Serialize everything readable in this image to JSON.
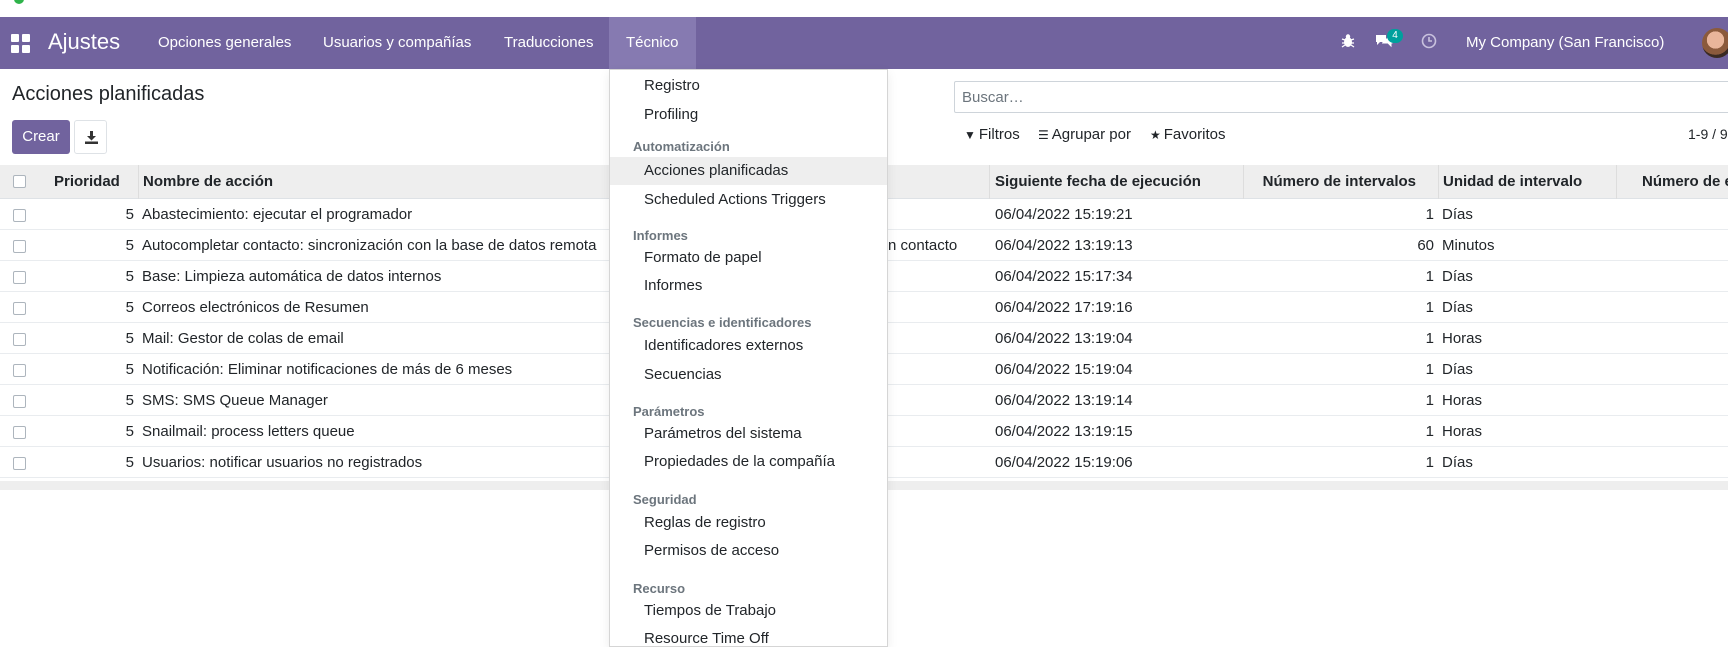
{
  "navbar": {
    "brand": "Ajustes",
    "menus": [
      "Opciones generales",
      "Usuarios y compañías",
      "Traducciones",
      "Técnico"
    ],
    "active_menu": "Técnico",
    "chat_badge": "4",
    "company": "My Company (San Francisco)"
  },
  "control_panel": {
    "title": "Acciones planificadas",
    "create_label": "Crear",
    "search_placeholder": "Buscar…",
    "filters_label": "Filtros",
    "group_by_label": "Agrupar por",
    "favorites_label": "Favoritos",
    "pager": "1-9 / 9"
  },
  "list": {
    "columns": {
      "priority": "Prioridad",
      "name": "Nombre de acción",
      "next_date": "Siguiente fecha de ejecución",
      "interval_number": "Número de intervalos",
      "interval_unit": "Unidad de intervalo",
      "calls": "Número de e"
    },
    "rows": [
      {
        "priority": "5",
        "name": "Abastecimiento: ejecutar el programador",
        "model": "",
        "next_date": "06/04/2022 15:19:21",
        "interval_number": "1",
        "interval_unit": "Días"
      },
      {
        "priority": "5",
        "name": "Autocompletar contacto: sincronización con la base de datos remota",
        "model": "n contacto",
        "next_date": "06/04/2022 13:19:13",
        "interval_number": "60",
        "interval_unit": "Minutos"
      },
      {
        "priority": "5",
        "name": "Base: Limpieza automática de datos internos",
        "model": "",
        "next_date": "06/04/2022 15:17:34",
        "interval_number": "1",
        "interval_unit": "Días"
      },
      {
        "priority": "5",
        "name": "Correos electrónicos de Resumen",
        "model": "",
        "next_date": "06/04/2022 17:19:16",
        "interval_number": "1",
        "interval_unit": "Días"
      },
      {
        "priority": "5",
        "name": "Mail: Gestor de colas de email",
        "model": "",
        "next_date": "06/04/2022 13:19:04",
        "interval_number": "1",
        "interval_unit": "Horas"
      },
      {
        "priority": "5",
        "name": "Notificación: Eliminar notificaciones de más de 6 meses",
        "model": "",
        "next_date": "06/04/2022 15:19:04",
        "interval_number": "1",
        "interval_unit": "Días"
      },
      {
        "priority": "5",
        "name": "SMS: SMS Queue Manager",
        "model": "",
        "next_date": "06/04/2022 13:19:14",
        "interval_number": "1",
        "interval_unit": "Horas"
      },
      {
        "priority": "5",
        "name": "Snailmail: process letters queue",
        "model": "",
        "next_date": "06/04/2022 13:19:15",
        "interval_number": "1",
        "interval_unit": "Horas"
      },
      {
        "priority": "5",
        "name": "Usuarios: notificar usuarios no registrados",
        "model": "",
        "next_date": "06/04/2022 15:19:06",
        "interval_number": "1",
        "interval_unit": "Días"
      }
    ]
  },
  "dropdown": {
    "items": [
      {
        "type": "item",
        "label": "Registro"
      },
      {
        "type": "item",
        "label": "Profiling"
      },
      {
        "type": "header",
        "label": "Automatización"
      },
      {
        "type": "item",
        "label": "Acciones planificadas",
        "active": true
      },
      {
        "type": "item",
        "label": "Scheduled Actions Triggers"
      },
      {
        "type": "header",
        "label": "Informes"
      },
      {
        "type": "item",
        "label": "Formato de papel"
      },
      {
        "type": "item",
        "label": "Informes"
      },
      {
        "type": "header",
        "label": "Secuencias e identificadores"
      },
      {
        "type": "item",
        "label": "Identificadores externos"
      },
      {
        "type": "item",
        "label": "Secuencias"
      },
      {
        "type": "header",
        "label": "Parámetros"
      },
      {
        "type": "item",
        "label": "Parámetros del sistema"
      },
      {
        "type": "item",
        "label": "Propiedades de la compañía"
      },
      {
        "type": "header",
        "label": "Seguridad"
      },
      {
        "type": "item",
        "label": "Reglas de registro"
      },
      {
        "type": "item",
        "label": "Permisos de acceso"
      },
      {
        "type": "header",
        "label": "Recurso"
      },
      {
        "type": "item",
        "label": "Tiempos de Trabajo"
      },
      {
        "type": "item",
        "label": "Resource Time Off"
      }
    ]
  },
  "colors": {
    "navbar": "#71639e",
    "active_menu": "#867ab1",
    "badge": "#00a09d"
  }
}
